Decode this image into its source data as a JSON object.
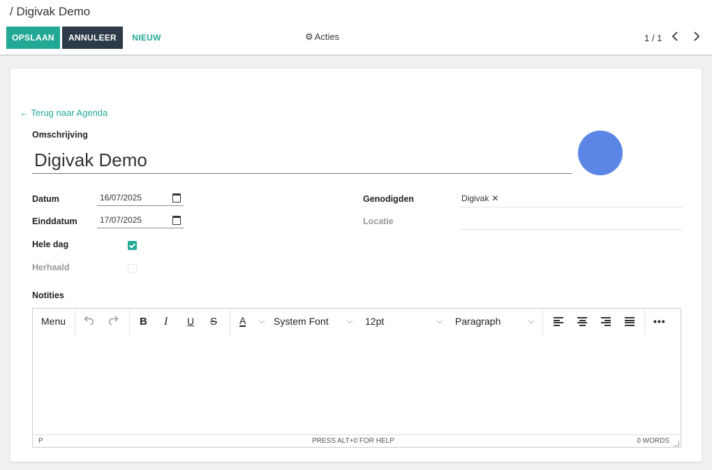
{
  "breadcrumb": "/ Digivak Demo",
  "toolbar": {
    "save_label": "OPSLAAN",
    "cancel_label": "ANNULEER",
    "new_label": "NIEUW",
    "actions_label": "Acties",
    "pager": "1 / 1"
  },
  "form": {
    "back_link": "Terug naar Agenda",
    "description_label": "Omschrijving",
    "description_value": "Digivak Demo",
    "date_label": "Datum",
    "date_value": "16/07/2025",
    "end_date_label": "Einddatum",
    "end_date_value": "17/07/2025",
    "all_day_label": "Hele dag",
    "all_day_checked": true,
    "recurring_label": "Herhaald",
    "recurring_checked": false,
    "attendees_label": "Genodigden",
    "attendees": [
      "Digivak"
    ],
    "location_label": "Locatie",
    "location_value": "",
    "notes_label": "Notities"
  },
  "editor": {
    "menu_label": "Menu",
    "font_family": "System Font",
    "font_size": "12pt",
    "block_format": "Paragraph",
    "status_path": "P",
    "help_text": "PRESS ALT+0 FOR HELP",
    "word_count": "0 WORDS"
  },
  "colors": {
    "accent": "#21a995",
    "cancel_bg": "#2d3b48",
    "avatar": "#5b86e5"
  }
}
